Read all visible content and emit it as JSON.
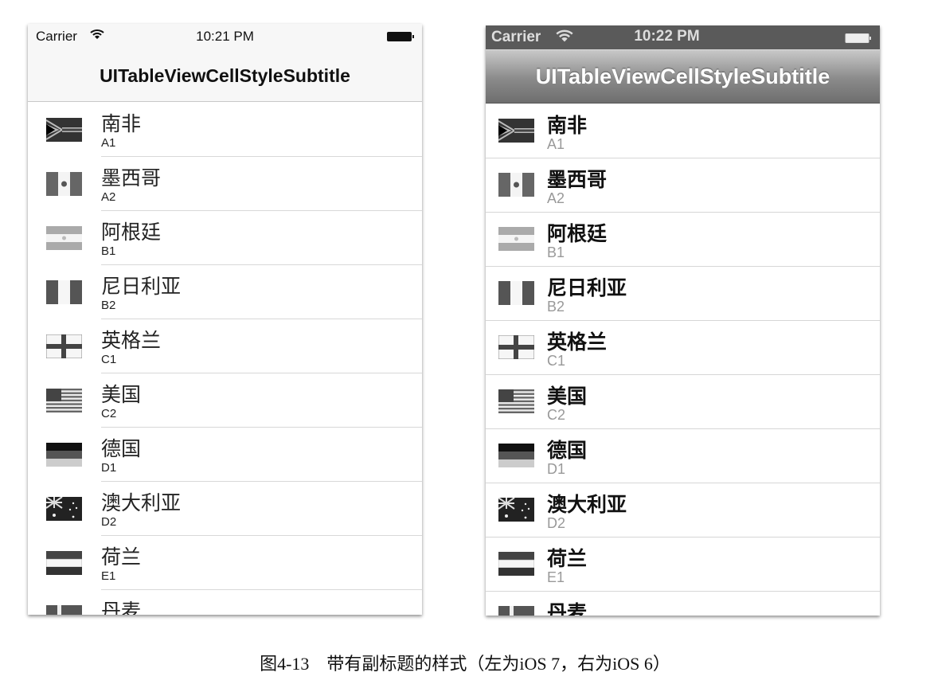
{
  "ios7": {
    "status": {
      "carrier": "Carrier",
      "time": "10:21 PM"
    },
    "nav_title": "UITableViewCellStyleSubtitle"
  },
  "ios6": {
    "status": {
      "carrier": "Carrier",
      "time": "10:22 PM"
    },
    "nav_title": "UITableViewCellStyleSubtitle"
  },
  "rows": [
    {
      "title": "南非",
      "subtitle": "A1",
      "flag": "south-africa"
    },
    {
      "title": "墨西哥",
      "subtitle": "A2",
      "flag": "mexico"
    },
    {
      "title": "阿根廷",
      "subtitle": "B1",
      "flag": "argentina"
    },
    {
      "title": "尼日利亚",
      "subtitle": "B2",
      "flag": "nigeria"
    },
    {
      "title": "英格兰",
      "subtitle": "C1",
      "flag": "england"
    },
    {
      "title": "美国",
      "subtitle": "C2",
      "flag": "usa"
    },
    {
      "title": "德国",
      "subtitle": "D1",
      "flag": "germany"
    },
    {
      "title": "澳大利亚",
      "subtitle": "D2",
      "flag": "australia"
    },
    {
      "title": "荷兰",
      "subtitle": "E1",
      "flag": "netherlands"
    },
    {
      "title": "丹麦",
      "subtitle": "",
      "flag": "denmark"
    }
  ],
  "caption": "图4-13　带有副标题的样式（左为iOS 7，右为iOS 6）"
}
